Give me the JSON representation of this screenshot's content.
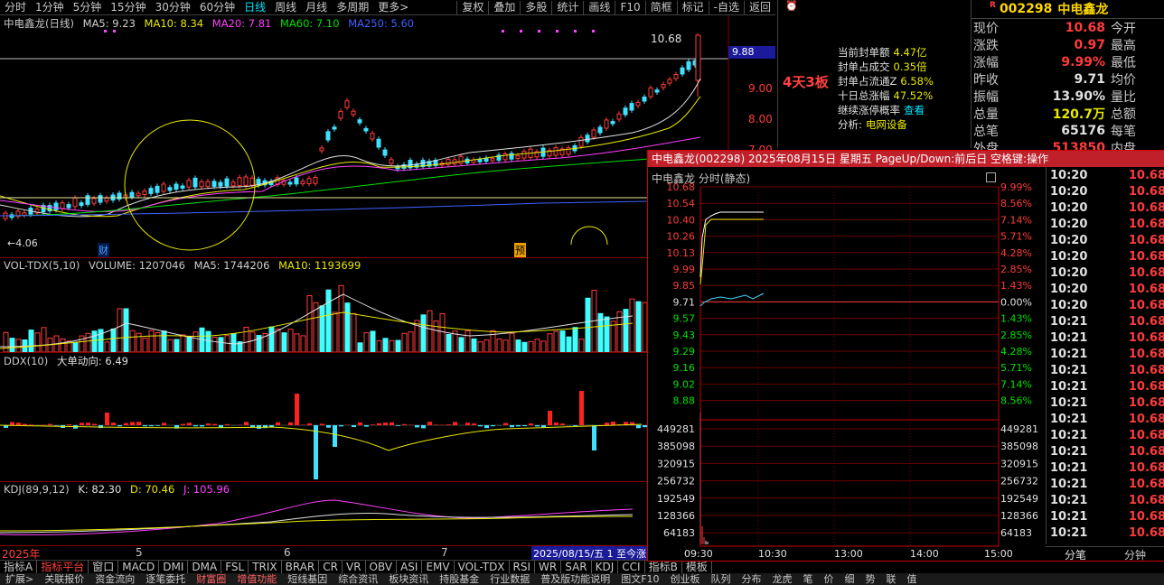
{
  "topbar": {
    "periods": [
      "分时",
      "1分钟",
      "5分钟",
      "15分钟",
      "30分钟",
      "60分钟",
      "日线",
      "周线",
      "月线",
      "多周期",
      "更多>"
    ],
    "active_period": "日线",
    "tools": [
      "复权",
      "叠加",
      "多股",
      "统计",
      "画线",
      "F10",
      "简框",
      "标记",
      "-自选",
      "返回"
    ]
  },
  "kline": {
    "header": {
      "name": "中电鑫龙(日线)",
      "ma5": "MA5: 9.23",
      "ma10": "MA10: 8.34",
      "ma20": "MA20: 7.81",
      "ma60": "MA60: 7.10",
      "ma250": "MA250: 5.60"
    },
    "high_label": "10.68",
    "low_label": "←4.06",
    "price_box": "9.88",
    "axis": [
      "9.00",
      "8.00",
      "7.00"
    ],
    "marker_cai": "财",
    "marker_yu": "预",
    "board_label": "4天3板"
  },
  "volume": {
    "header": {
      "name": "VOL-TDX(5,10)",
      "volume": "VOLUME: 1207046",
      "ma5": "MA5: 1744206",
      "ma10": "MA10: 1193699"
    }
  },
  "ddx": {
    "header": {
      "name": "DDX(10)",
      "big": "大单动向: 6.49"
    }
  },
  "kdj": {
    "header": {
      "name": "KDJ(89,9,12)",
      "k": "K: 82.30",
      "d": "D: 70.46",
      "j": "J: 105.96"
    },
    "dates": [
      "2025年",
      "5",
      "6",
      "7"
    ],
    "range_label": "2025/08/15/五 1 至今涨"
  },
  "bottom_tabs": [
    "指标A",
    "指标平台",
    "窗口",
    "MACD",
    "DMI",
    "DMA",
    "FSL",
    "TRIX",
    "BRAR",
    "CR",
    "VR",
    "OBV",
    "ASI",
    "EMV",
    "VOL-TDX",
    "RSI",
    "WR",
    "SAR",
    "KDJ",
    "CCI",
    "指标B",
    "模板"
  ],
  "bottom_active": "指标平台",
  "statusbar": [
    "扩展>",
    "关联报价",
    "资金流向",
    "逐笔委托",
    "财富圈",
    "增值功能",
    "短线基因",
    "综合资讯",
    "板块资讯",
    "持股基金",
    "行业数据",
    "普及版功能说明",
    "图文F10",
    "创业板",
    "队列",
    "分布",
    "龙虎",
    "笔",
    "价",
    "细",
    "势",
    "联",
    "值"
  ],
  "info": {
    "items": [
      {
        "label": "当前封单额",
        "value": "4.47亿"
      },
      {
        "label": "封单占成交",
        "value": "0.35倍"
      },
      {
        "label": "封单占流通Z",
        "value": "6.58%"
      },
      {
        "label": "十日总涨幅",
        "value": "47.52%"
      },
      {
        "label": "继续涨停概率",
        "value": "查看"
      },
      {
        "label": "分析:",
        "value": "电网设备"
      }
    ]
  },
  "quote": {
    "code": "002298",
    "name": "中电鑫龙",
    "rows": [
      {
        "l1": "现价",
        "v1": "10.68",
        "l2": "今开"
      },
      {
        "l1": "涨跌",
        "v1": "0.97",
        "l2": "最高"
      },
      {
        "l1": "涨幅",
        "v1": "9.99%",
        "l2": "最低"
      },
      {
        "l1": "昨收",
        "v1": "9.71",
        "l2": "均价"
      },
      {
        "l1": "振幅",
        "v1": "13.90%",
        "l2": "量比"
      },
      {
        "l1": "总量",
        "v1": "120.7万",
        "l2": "总额"
      },
      {
        "l1": "总笔",
        "v1": "65176",
        "l2": "每笔"
      },
      {
        "l1": "外盘",
        "v1": "513850",
        "l2": "内盘"
      }
    ]
  },
  "popup": {
    "title": "中电鑫龙(002298) 2025年08月15日 星期五 PageUp/Down:前后日 空格键:操作",
    "subtitle": "中电鑫龙  分时(静态)",
    "price_axis": [
      "10.68",
      "10.54",
      "10.40",
      "10.26",
      "10.13",
      "9.99",
      "9.85",
      "9.71",
      "9.57",
      "9.43",
      "9.29",
      "9.16",
      "9.02",
      "8.88"
    ],
    "pct_axis": [
      "9.99%",
      "8.56%",
      "7.14%",
      "5.71%",
      "4.28%",
      "2.85%",
      "1.43%",
      "0.00%",
      "1.43%",
      "2.85%",
      "4.28%",
      "5.71%",
      "7.14%",
      "8.56%"
    ],
    "vol_axis": [
      "449281",
      "385098",
      "320915",
      "256732",
      "192549",
      "128366",
      "64183"
    ],
    "time_axis": [
      "09:30",
      "10:30",
      "13:00",
      "14:00",
      "15:00"
    ],
    "ticks": [
      {
        "t": "10:20",
        "p": "10.68"
      },
      {
        "t": "10:20",
        "p": "10.68"
      },
      {
        "t": "10:20",
        "p": "10.68"
      },
      {
        "t": "10:20",
        "p": "10.68"
      },
      {
        "t": "10:20",
        "p": "10.68"
      },
      {
        "t": "10:20",
        "p": "10.68"
      },
      {
        "t": "10:20",
        "p": "10.68"
      },
      {
        "t": "10:20",
        "p": "10.68"
      },
      {
        "t": "10:20",
        "p": "10.68"
      },
      {
        "t": "10:21",
        "p": "10.68"
      },
      {
        "t": "10:21",
        "p": "10.68"
      },
      {
        "t": "10:21",
        "p": "10.68"
      },
      {
        "t": "10:21",
        "p": "10.68"
      },
      {
        "t": "10:21",
        "p": "10.68"
      },
      {
        "t": "10:21",
        "p": "10.68"
      },
      {
        "t": "10:21",
        "p": "10.68"
      },
      {
        "t": "10:21",
        "p": "10.68"
      },
      {
        "t": "10:21",
        "p": "10.68"
      },
      {
        "t": "10:21",
        "p": "10.68"
      },
      {
        "t": "10:21",
        "p": "10.68"
      },
      {
        "t": "10:21",
        "p": "10.68"
      },
      {
        "t": "10:21",
        "p": "10.68"
      },
      {
        "t": "10:21",
        "p": "10.68"
      }
    ],
    "tabs": [
      "分笔",
      "分钟"
    ]
  }
}
